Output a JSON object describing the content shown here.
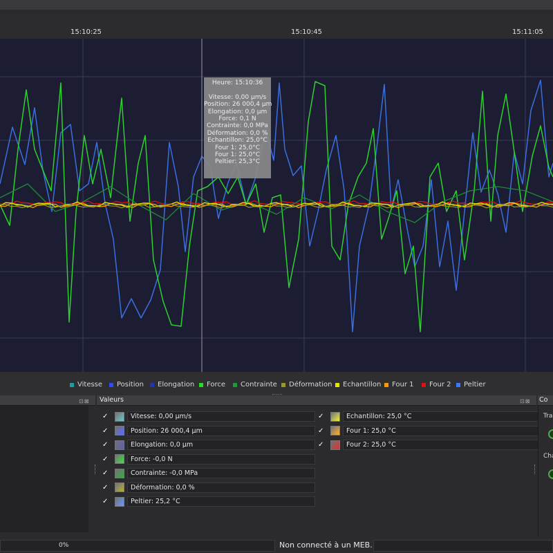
{
  "time_axis": {
    "ticks": [
      "15:10:25",
      "15:10:45",
      "15:11:05"
    ]
  },
  "tooltip": {
    "lines": [
      "Heure: 15:10:36",
      "",
      "Vitesse: 0,00 µm/s",
      "Position: 26 000,4 µm",
      "Elongation: 0,0 µm",
      "Force: 0,1 N",
      "Contrainte: 0,0 MPa",
      "Déformation: 0,0 %",
      "Echantillon: 25,0°C",
      "Four 1: 25,0°C",
      "Four 1: 25,0°C",
      "Peltier: 25,3°C"
    ]
  },
  "legend": [
    {
      "label": "Vitesse",
      "color": "#1aa0a0"
    },
    {
      "label": "Position",
      "color": "#2a4cff"
    },
    {
      "label": "Elongation",
      "color": "#2233bb"
    },
    {
      "label": "Force",
      "color": "#22dd22"
    },
    {
      "label": "Contrainte",
      "color": "#1f9a3a"
    },
    {
      "label": "Déformation",
      "color": "#9a9a20"
    },
    {
      "label": "Echantillon",
      "color": "#e6e600"
    },
    {
      "label": "Four 1",
      "color": "#ff9900"
    },
    {
      "label": "Four 2",
      "color": "#dd1111"
    },
    {
      "label": "Peltier",
      "color": "#3a7aff"
    }
  ],
  "panels": {
    "values_title": "Valeurs",
    "right_title": "Co",
    "right_label_1": "Tra",
    "right_label_2": "Cha"
  },
  "values_left": [
    {
      "text": "Vitesse: 0,00 µm/s",
      "swatch": "#6fc8c8",
      "checked": "✓"
    },
    {
      "text": "Position: 26 000,4 µm",
      "swatch": "#5a6cff",
      "checked": "✓"
    },
    {
      "text": "Elongation: 0,0 µm",
      "swatch": "#5a5fb0",
      "checked": "✓"
    },
    {
      "text": "Force: -0,0 N",
      "swatch": "#44dd44",
      "checked": "✓"
    },
    {
      "text": "Contrainte: -0,0 MPa",
      "swatch": "#3aaa4a",
      "checked": "✓"
    },
    {
      "text": "Déformation: 0,0 %",
      "swatch": "#b0b040",
      "checked": "✓"
    },
    {
      "text": "Peltier: 25,2 °C",
      "swatch": "#6a9aff",
      "checked": "✓"
    }
  ],
  "values_right": [
    {
      "text": "Echantillon: 25,0 °C",
      "swatch": "#f0f040",
      "checked": "✓"
    },
    {
      "text": "Four 1: 25,0 °C",
      "swatch": "#ffb030",
      "checked": "✓"
    },
    {
      "text": "Four 2: 25,0 °C",
      "swatch": "#e03030",
      "checked": "✓"
    }
  ],
  "status": {
    "progress_text": "0%",
    "progress": 0,
    "message": "Non connecté à un MEB."
  }
}
